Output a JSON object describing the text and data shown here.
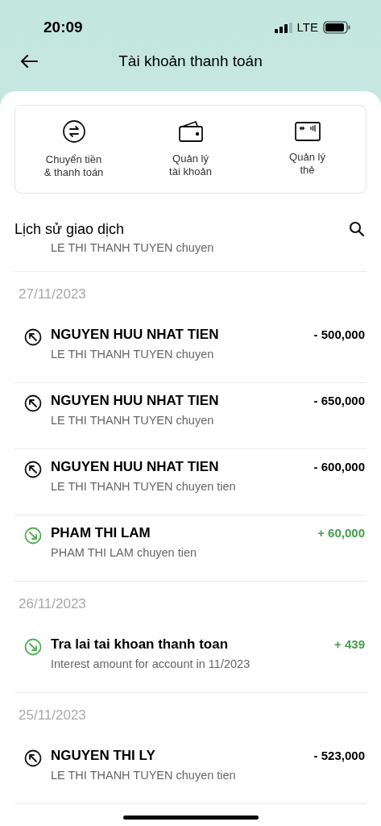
{
  "status_bar": {
    "time": "20:09",
    "network": "LTE"
  },
  "header": {
    "title": "Tài khoản thanh toán"
  },
  "actions": [
    {
      "kind": "transfer",
      "label": "Chuyển tiền\n& thanh toán"
    },
    {
      "kind": "wallet",
      "label": "Quản lý\ntài khoản"
    },
    {
      "kind": "card",
      "label": "Quản lý\nthẻ"
    }
  ],
  "history": {
    "title": "Lịch sử giao dịch",
    "items": [
      {
        "kind": "transaction",
        "note": "LE THI THANH TUYEN chuyen"
      },
      {
        "kind": "date",
        "label": "27/11/2023"
      },
      {
        "kind": "transaction",
        "incoming": false,
        "name": "NGUYEN HUU NHAT TIEN",
        "note": "LE THI THANH TUYEN chuyen",
        "amount": "- 500,000"
      },
      {
        "kind": "transaction",
        "incoming": false,
        "name": "NGUYEN HUU NHAT TIEN",
        "note": "LE THI THANH TUYEN chuyen",
        "amount": "- 650,000"
      },
      {
        "kind": "transaction",
        "incoming": false,
        "name": "NGUYEN HUU NHAT TIEN",
        "note": "LE THI THANH TUYEN chuyen tien",
        "amount": "- 600,000"
      },
      {
        "kind": "transaction",
        "incoming": true,
        "name": "PHAM THI LAM",
        "note": "PHAM THI LAM chuyen tien",
        "amount": "+ 60,000"
      },
      {
        "kind": "date",
        "label": "26/11/2023"
      },
      {
        "kind": "transaction",
        "incoming": true,
        "name": "Tra lai tai khoan thanh toan",
        "note": "Interest amount for account in 11/2023",
        "amount": "+ 439"
      },
      {
        "kind": "date",
        "label": "25/11/2023"
      },
      {
        "kind": "transaction",
        "incoming": false,
        "name": "NGUYEN THI LY",
        "note": "LE THI THANH TUYEN chuyen tien",
        "amount": "- 523,000"
      }
    ]
  }
}
